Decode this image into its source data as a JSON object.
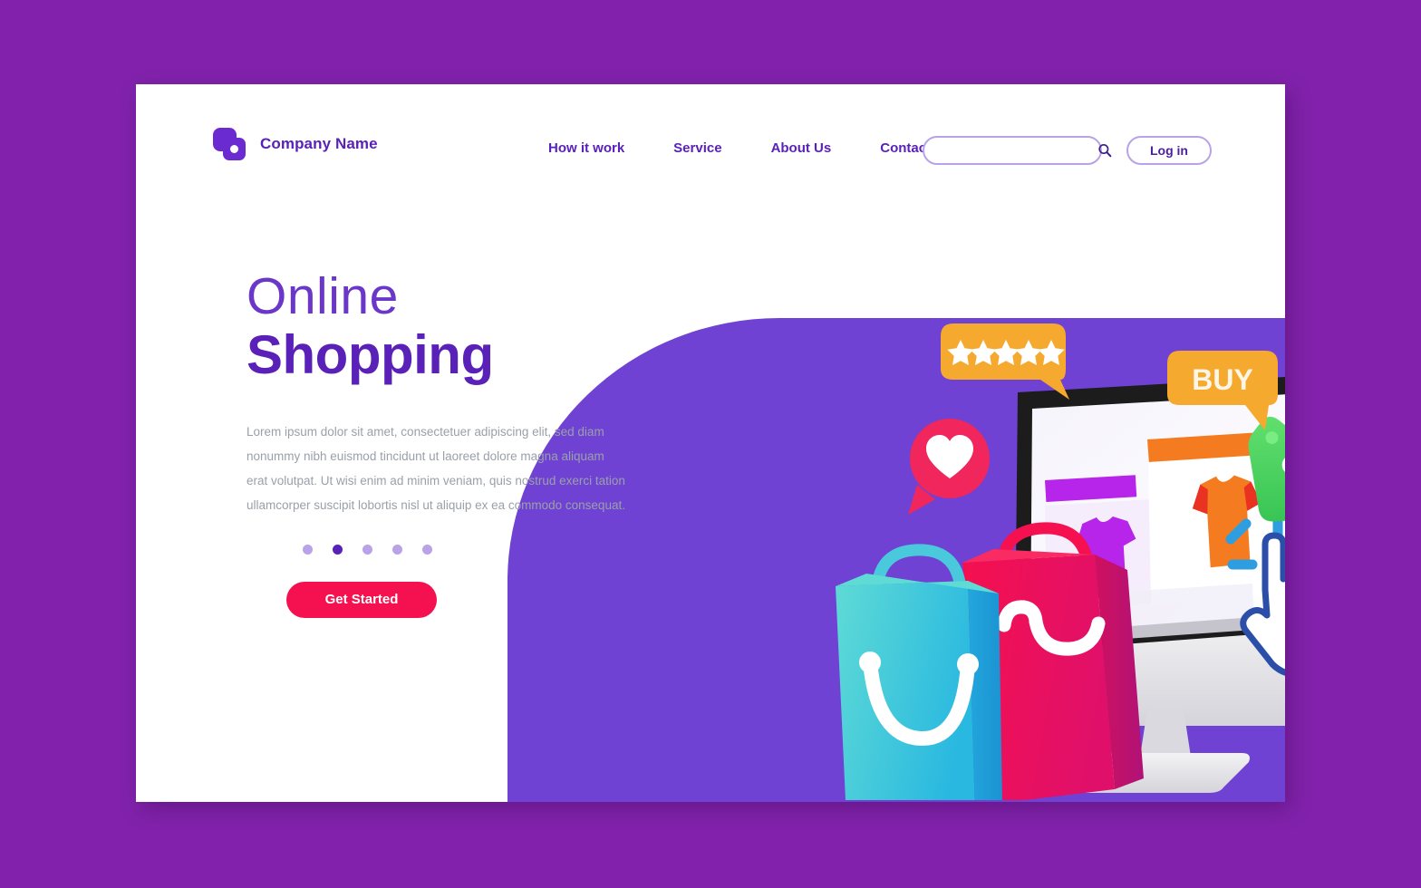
{
  "page": {
    "background_color": "#8222ac",
    "card_background": "#ffffff"
  },
  "header": {
    "brand": {
      "name": "Company Name",
      "logo_icon": "stacked-squares-icon",
      "color": "#5a21b8"
    },
    "nav": [
      {
        "label": "How it work"
      },
      {
        "label": "Service"
      },
      {
        "label": "About Us"
      },
      {
        "label": "Contact"
      }
    ],
    "search": {
      "value": "",
      "placeholder": "",
      "icon": "search-icon"
    },
    "login": {
      "label": "Log in"
    }
  },
  "hero": {
    "title_light": "Online",
    "title_bold": "Shopping",
    "body": "Lorem ipsum dolor sit amet, consectetuer adipiscing elit, sed diam nonummy nibh euismod tincidunt ut laoreet dolore magna aliquam erat volutpat. Ut wisi enim ad minim veniam, quis nostrud exerci tation ullamcorper suscipit lobortis nisl ut aliquip ex ea commodo consequat.",
    "carousel": {
      "total": 5,
      "active_index": 1,
      "active_color": "#5a21b8",
      "inactive_color": "#b9a2e8"
    },
    "cta": {
      "label": "Get Started",
      "color": "#f5104f"
    }
  },
  "illustration": {
    "name": "online-shopping-illustration",
    "blob_color": "#6f42d4",
    "rating_bubble": {
      "name": "rating-stars-bubble",
      "color": "#f5a92e",
      "stars": 5,
      "star_glyph": "★"
    },
    "buy_bubble": {
      "name": "buy-badge",
      "label": "BUY",
      "color": "#f5a92e"
    },
    "heart_bubble": {
      "name": "heart-bubble",
      "color": "#f0265c",
      "glyph": "heart-icon"
    },
    "discount_tag": {
      "name": "discount-tag",
      "label": "%",
      "color": "#4cd964"
    },
    "monitor": {
      "name": "desktop-monitor",
      "bezel_color": "#1c1c1c",
      "screen_color": "#f2f0fa",
      "stand_color": "#e2e2e6",
      "product_card_orange": "#f57b20",
      "product_card_purple": "#b724ea",
      "tshirt_orange": "#f57b20",
      "tshirt_orange_sleeve": "#ea3223",
      "tshirt_purple": "#b724ea",
      "cursor": "pointing-hand-cursor",
      "click_burst_color": "#2f9ee0"
    },
    "bag_front": {
      "name": "shopping-bag-cyan",
      "color": "#3ec8dc",
      "smile": "white-smile-curve"
    },
    "bag_back": {
      "name": "shopping-bag-pink",
      "color": "#ee0f57",
      "smile": "white-smile-curve"
    }
  }
}
